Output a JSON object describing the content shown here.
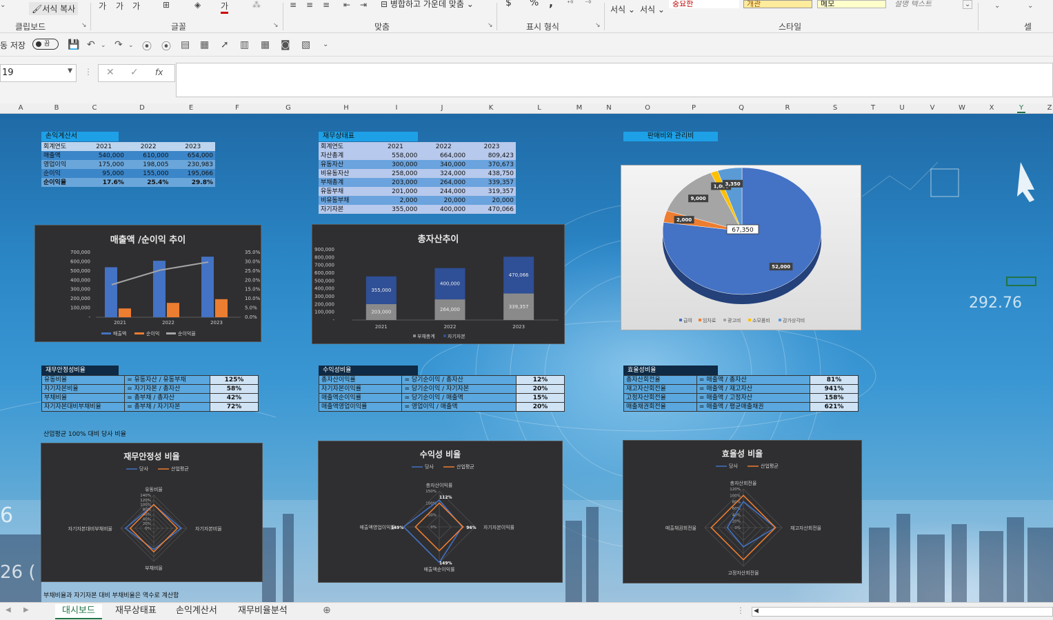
{
  "ribbon": {
    "format_painter": "서식 복사",
    "groups": {
      "clipboard": "클립보드",
      "font": "글꼴",
      "alignment": "맞춤",
      "number": "표시 형식",
      "styles": "스타일",
      "cells": "셀"
    },
    "merge_center": "병합하고 가운데 맞춤",
    "cond_format": "서식",
    "table_format": "서식",
    "style_boxes": [
      "중요한",
      "개관",
      "메모",
      "설명 텍스트"
    ],
    "number_symbols": {
      "currency": "$",
      "percent": "%",
      "comma": ","
    }
  },
  "qat": {
    "autosave_label": "동 저장",
    "toggle": "끔"
  },
  "formula_bar": {
    "name_box": "19",
    "fx": "fx",
    "value": ""
  },
  "columns": [
    "A",
    "B",
    "C",
    "D",
    "E",
    "F",
    "G",
    "H",
    "I",
    "J",
    "K",
    "L",
    "M",
    "N",
    "O",
    "P",
    "Q",
    "R",
    "S",
    "T",
    "U",
    "V",
    "W",
    "X",
    "Y",
    "Z"
  ],
  "income_statement": {
    "title": "손익계산서",
    "header": [
      "회계연도",
      "2021",
      "2022",
      "2023"
    ],
    "rows": [
      [
        "매출액",
        "540,000",
        "610,000",
        "654,000"
      ],
      [
        "영업이익",
        "175,000",
        "198,005",
        "230,983"
      ],
      [
        "순이익",
        "95,000",
        "155,000",
        "195,066"
      ],
      [
        "순이익율",
        "17.6%",
        "25.4%",
        "29.8%"
      ]
    ]
  },
  "balance_sheet": {
    "title": "재무상태표",
    "header": [
      "회계연도",
      "2021",
      "2022",
      "2023"
    ],
    "rows": [
      [
        "자산총계",
        "558,000",
        "664,000",
        "809,423"
      ],
      [
        "유동자산",
        "300,000",
        "340,000",
        "370,673"
      ],
      [
        "비유동자산",
        "258,000",
        "324,000",
        "438,750"
      ],
      [
        "부채총계",
        "203,000",
        "264,000",
        "339,357"
      ],
      [
        "유동부채",
        "201,000",
        "244,000",
        "319,357"
      ],
      [
        "비유동부채",
        "2,000",
        "20,000",
        "20,000"
      ],
      [
        "자기자본",
        "355,000",
        "400,000",
        "470,066"
      ]
    ]
  },
  "sga_title": "판매비와 관리비",
  "stability": {
    "title": "재무안정성비율",
    "rows": [
      [
        "유동비율",
        "= 유동자산 / 유동부채",
        "125%"
      ],
      [
        "자기자본비율",
        "= 자기자본 / 총자산",
        "58%"
      ],
      [
        "부채비율",
        "= 총부채 / 총자산",
        "42%"
      ],
      [
        "자기자본대비부채비율",
        "= 총부채 / 자기자본",
        "72%"
      ]
    ]
  },
  "profitability": {
    "title": "수익성비율",
    "rows": [
      [
        "총자산이익률",
        "= 당기순이익 / 총자산",
        "12%"
      ],
      [
        "자기자본이익률",
        "= 당기순이익 / 자기자본",
        "20%"
      ],
      [
        "매출액순이익률",
        "= 당기순이익 / 매출액",
        "15%"
      ],
      [
        "매출액영업이익률",
        "= 영업이익 / 매출액",
        "20%"
      ]
    ]
  },
  "efficiency": {
    "title": "효율성비율",
    "rows": [
      [
        "총자산회전율",
        "= 매출액 / 총자산",
        "81%"
      ],
      [
        "재고자산회전율",
        "= 매출액 / 재고자산",
        "941%"
      ],
      [
        "고정자산회전율",
        "= 매출액 / 고정자산",
        "158%"
      ],
      [
        "매출채권회전율",
        "= 매출액 / 평균매출채권",
        "621%"
      ]
    ]
  },
  "industry_note": "산업평균 100% 대비 당사 비율",
  "bottom_note": "부채비율과 자기자본 대비 부채비율은 역수로 계산함",
  "chart_data": [
    {
      "type": "bar",
      "title": "매출액 /순이익 추이",
      "categories": [
        "2021",
        "2022",
        "2023"
      ],
      "series": [
        {
          "name": "매출액",
          "values": [
            540000,
            610000,
            654000
          ]
        },
        {
          "name": "순이익",
          "values": [
            95000,
            155000,
            195066
          ]
        },
        {
          "name": "순이익율",
          "values": [
            17.6,
            25.4,
            29.8
          ],
          "axis": "secondary"
        }
      ],
      "ylim": [
        0,
        700000
      ],
      "y_ticks": [
        "-",
        "100,000",
        "200,000",
        "300,000",
        "400,000",
        "500,000",
        "600,000",
        "700,000"
      ],
      "y2_ticks": [
        "0.0%",
        "5.0%",
        "10.0%",
        "15.0%",
        "20.0%",
        "25.0%",
        "30.0%",
        "35.0%"
      ],
      "colors": {
        "bar1": "#4472c4",
        "bar2": "#ed7d31",
        "line": "#a5a5a5"
      }
    },
    {
      "type": "bar",
      "title": "총자산추이",
      "categories": [
        "2021",
        "2022",
        "2023"
      ],
      "series": [
        {
          "name": "부채총계",
          "values": [
            203000,
            264000,
            339357
          ]
        },
        {
          "name": "자기자본",
          "values": [
            355000,
            400000,
            470066
          ]
        }
      ],
      "ylim": [
        0,
        900000
      ],
      "y_ticks": [
        "-",
        "100,000",
        "200,000",
        "300,000",
        "400,000",
        "500,000",
        "600,000",
        "700,000",
        "800,000",
        "900,000"
      ],
      "colors": {
        "debt": "#8a8a8a",
        "equity": "#2f4f96"
      }
    },
    {
      "type": "pie",
      "slices": [
        {
          "name": "급여",
          "value": 52000,
          "color": "#4472c4"
        },
        {
          "name": "임차료",
          "value": 2000,
          "color": "#ed7d31"
        },
        {
          "name": "광고비",
          "value": 9000,
          "color": "#a5a5a5"
        },
        {
          "name": "소모품비",
          "value": 1000,
          "color": "#ffc000"
        },
        {
          "name": "감가상각비",
          "value": 3350,
          "color": "#5b9bd5"
        }
      ],
      "total_label": "67,350"
    },
    {
      "type": "radar",
      "title": "재무안정성 비율",
      "axes": [
        "유동비율",
        "자기자본비율",
        "부채비율",
        "자기자본대비부채비율"
      ],
      "series": [
        {
          "name": "당사",
          "values": [
            1.0,
            1.15,
            0.9,
            1.2
          ],
          "color": "#4472c4"
        },
        {
          "name": "산업평균",
          "values": [
            1.0,
            1.0,
            1.0,
            1.0
          ],
          "color": "#ed7d31"
        }
      ],
      "ticks": [
        "0%",
        "20%",
        "40%",
        "60%",
        "80%",
        "100%",
        "120%",
        "140%"
      ]
    },
    {
      "type": "radar",
      "title": "수익성 비율",
      "axes": [
        "총자산이익률",
        "자기자본이익률",
        "매출액순이익률",
        "매출액영업이익률"
      ],
      "series": [
        {
          "name": "당사",
          "values": [
            1.12,
            0.96,
            1.49,
            1.49
          ],
          "color": "#4472c4"
        },
        {
          "name": "산업평균",
          "values": [
            1.0,
            1.0,
            1.0,
            1.0
          ],
          "color": "#ed7d31"
        }
      ],
      "point_labels": [
        "112%",
        "96%",
        "149%",
        "149%"
      ],
      "ticks": [
        "0%",
        "50%",
        "100%",
        "150%"
      ]
    },
    {
      "type": "radar",
      "title": "효율성 비율",
      "axes": [
        "총자산회전율",
        "재고자산회전율",
        "고정자산회전율",
        "매출채권회전율"
      ],
      "series": [
        {
          "name": "당사",
          "values": [
            0.81,
            0.99,
            0.6,
            0.5
          ],
          "color": "#4472c4"
        },
        {
          "name": "산업평균",
          "values": [
            1.0,
            1.0,
            1.0,
            1.0
          ],
          "color": "#ed7d31"
        }
      ],
      "ticks": [
        "0%",
        "20%",
        "40%",
        "60%",
        "80%",
        "100%",
        "120%"
      ]
    }
  ],
  "tabs": [
    "대시보드",
    "재무상태표",
    "손익계산서",
    "재무비율분석"
  ],
  "active_tab": 0
}
